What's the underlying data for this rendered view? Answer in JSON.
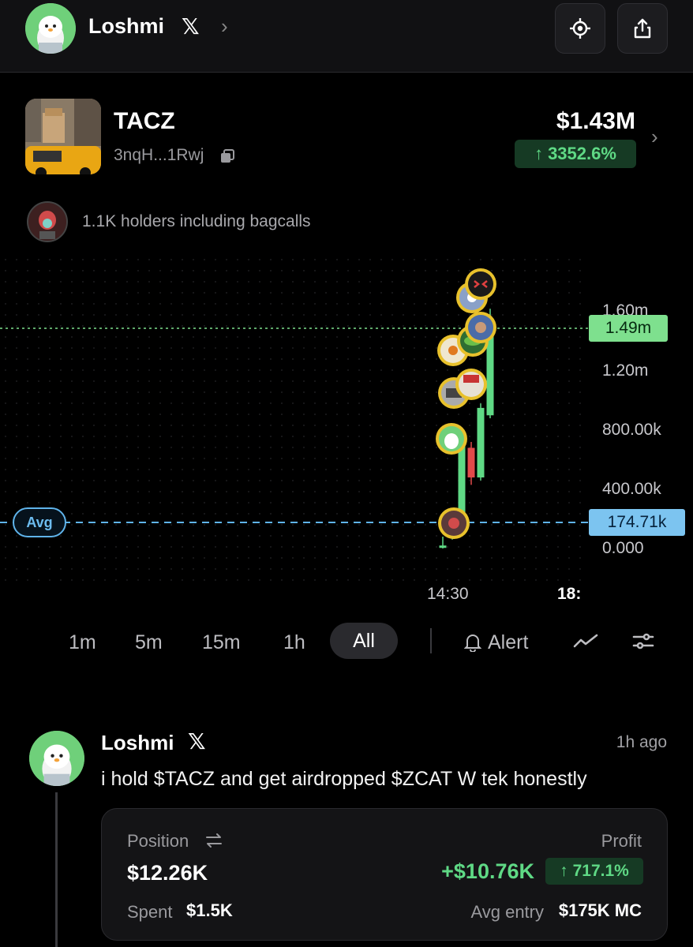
{
  "header": {
    "user_name": "Loshmi",
    "x_glyph": "𝕏",
    "chevron": "›",
    "icons": [
      "crosshair-icon",
      "share-icon"
    ]
  },
  "token": {
    "name": "TACZ",
    "address": "3nqH...1Rwj",
    "market_cap": "$1.43M",
    "change": "3352.6%",
    "change_arrow": "↑",
    "holders_text": "1.1K holders including bagcalls"
  },
  "chart": {
    "price_tag": "1.49m",
    "avg_tag": "174.71k",
    "avg_label": "Avg",
    "y_labels": [
      "1.60m",
      "1.20m",
      "800.00k",
      "400.00k",
      "0.000"
    ],
    "x_labels": [
      "14:30",
      "18:"
    ]
  },
  "chart_data": {
    "type": "candlestick",
    "y_unit": "market cap",
    "ylim": [
      0,
      1600000
    ],
    "current_value": 1490000,
    "avg_entry": 174710,
    "x_ticks": [
      "14:30",
      "18:"
    ],
    "candles": [
      {
        "open": 20000,
        "close": 20000,
        "high": 80000,
        "low": 0,
        "direction": "up"
      },
      {
        "open": 80000,
        "close": 170000,
        "high": 200000,
        "low": 60000,
        "direction": "up"
      },
      {
        "open": 170000,
        "close": 700000,
        "high": 760000,
        "low": 150000,
        "direction": "up"
      },
      {
        "open": 680000,
        "close": 480000,
        "high": 720000,
        "low": 430000,
        "direction": "down"
      },
      {
        "open": 480000,
        "close": 950000,
        "high": 980000,
        "low": 460000,
        "direction": "up"
      },
      {
        "open": 900000,
        "close": 1490000,
        "high": 1620000,
        "low": 880000,
        "direction": "up"
      }
    ],
    "colors": {
      "up": "#5fd985",
      "down": "#e24a4a",
      "avg_line": "#5fb3ea",
      "price_line": "#7ee08e"
    }
  },
  "timeframes": {
    "items": [
      "1m",
      "5m",
      "15m",
      "1h"
    ],
    "active": "All",
    "alert_label": "Alert",
    "tool_icons": [
      "line-chart-icon",
      "settings-sliders-icon"
    ]
  },
  "post": {
    "user_name": "Loshmi",
    "x_glyph": "𝕏",
    "time": "1h ago",
    "text": "i hold $TACZ and get airdropped $ZCAT W tek honestly"
  },
  "position": {
    "position_label": "Position",
    "position_value": "$12.26K",
    "spent_label": "Spent",
    "spent_value": "$1.5K",
    "profit_label": "Profit",
    "profit_value": "+$10.76K",
    "profit_pct": "717.1%",
    "profit_arrow": "↑",
    "avg_entry_label": "Avg entry",
    "avg_entry_value": "$175K MC"
  },
  "colors": {
    "background": "#000000",
    "positive": "#5fd985",
    "negative": "#e24a4a",
    "accent_blue": "#5fb3ea"
  }
}
